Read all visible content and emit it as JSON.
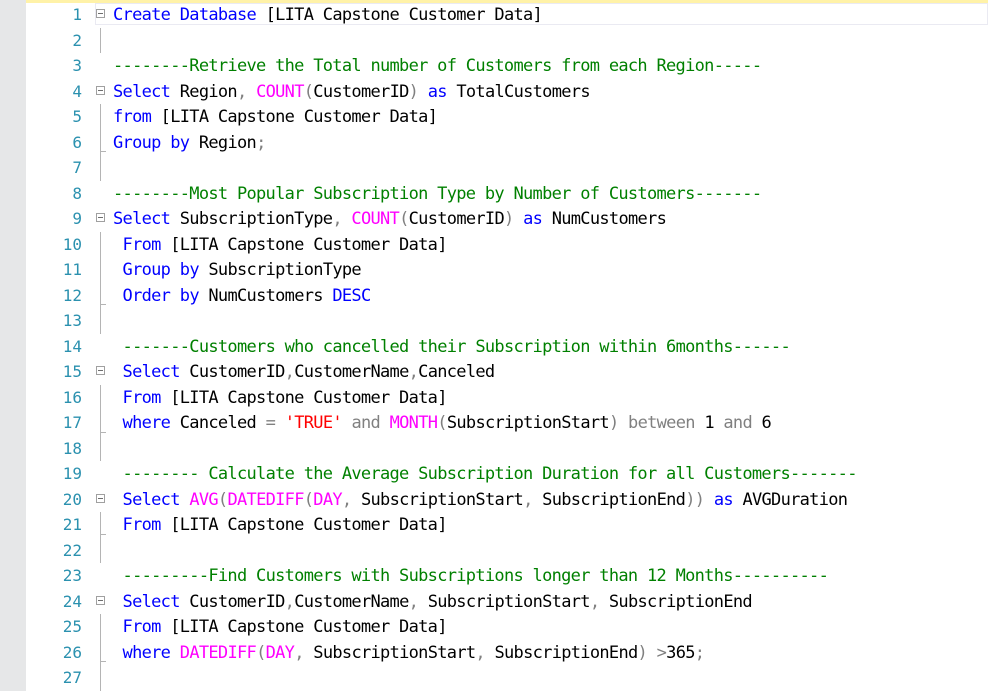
{
  "editor": {
    "colors": {
      "keyword": "#0000ff",
      "function": "#ff00ff",
      "comment": "#008000",
      "operator": "#808080",
      "string": "#ff0000",
      "text": "#000000",
      "line_number": "#2b91af"
    },
    "lines": [
      {
        "n": "1",
        "fold": true,
        "tokens": [
          [
            "kw",
            "Create"
          ],
          [
            "tx",
            " "
          ],
          [
            "kw",
            "Database"
          ],
          [
            "tx",
            " [LITA Capstone Customer Data]"
          ]
        ]
      },
      {
        "n": "2",
        "tokens": []
      },
      {
        "n": "3",
        "tokens": [
          [
            "cm",
            "--------Retrieve the Total number of Customers from each Region-----"
          ]
        ]
      },
      {
        "n": "4",
        "fold": true,
        "tokens": [
          [
            "kw",
            "Select"
          ],
          [
            "tx",
            " Region"
          ],
          [
            "op",
            ","
          ],
          [
            "tx",
            " "
          ],
          [
            "fn",
            "COUNT"
          ],
          [
            "op",
            "("
          ],
          [
            "tx",
            "CustomerID"
          ],
          [
            "op",
            ")"
          ],
          [
            "tx",
            " "
          ],
          [
            "kw",
            "as"
          ],
          [
            "tx",
            " TotalCustomers"
          ]
        ]
      },
      {
        "n": "5",
        "tokens": [
          [
            "kw",
            "from"
          ],
          [
            "tx",
            " [LITA Capstone Customer Data]"
          ]
        ]
      },
      {
        "n": "6",
        "tokens": [
          [
            "kw",
            "Group"
          ],
          [
            "tx",
            " "
          ],
          [
            "kw",
            "by"
          ],
          [
            "tx",
            " Region"
          ],
          [
            "op",
            ";"
          ]
        ]
      },
      {
        "n": "7",
        "tokens": []
      },
      {
        "n": "8",
        "tokens": [
          [
            "cm",
            "--------Most Popular Subscription Type by Number of Customers-------"
          ]
        ]
      },
      {
        "n": "9",
        "fold": true,
        "tokens": [
          [
            "kw",
            "Select"
          ],
          [
            "tx",
            " SubscriptionType"
          ],
          [
            "op",
            ","
          ],
          [
            "tx",
            " "
          ],
          [
            "fn",
            "COUNT"
          ],
          [
            "op",
            "("
          ],
          [
            "tx",
            "CustomerID"
          ],
          [
            "op",
            ")"
          ],
          [
            "tx",
            " "
          ],
          [
            "kw",
            "as"
          ],
          [
            "tx",
            " NumCustomers"
          ]
        ]
      },
      {
        "n": "10",
        "tokens": [
          [
            "tx",
            " "
          ],
          [
            "kw",
            "From"
          ],
          [
            "tx",
            " [LITA Capstone Customer Data]"
          ]
        ]
      },
      {
        "n": "11",
        "tokens": [
          [
            "tx",
            " "
          ],
          [
            "kw",
            "Group"
          ],
          [
            "tx",
            " "
          ],
          [
            "kw",
            "by"
          ],
          [
            "tx",
            " SubscriptionType"
          ]
        ]
      },
      {
        "n": "12",
        "tokens": [
          [
            "tx",
            " "
          ],
          [
            "kw",
            "Order"
          ],
          [
            "tx",
            " "
          ],
          [
            "kw",
            "by"
          ],
          [
            "tx",
            " NumCustomers "
          ],
          [
            "kw",
            "DESC"
          ]
        ]
      },
      {
        "n": "13",
        "tokens": []
      },
      {
        "n": "14",
        "tokens": [
          [
            "tx",
            " "
          ],
          [
            "cm",
            "-------Customers who cancelled their Subscription within 6months------"
          ]
        ]
      },
      {
        "n": "15",
        "fold": true,
        "tokens": [
          [
            "tx",
            " "
          ],
          [
            "kw",
            "Select"
          ],
          [
            "tx",
            " CustomerID"
          ],
          [
            "op",
            ","
          ],
          [
            "tx",
            "CustomerName"
          ],
          [
            "op",
            ","
          ],
          [
            "tx",
            "Canceled"
          ]
        ]
      },
      {
        "n": "16",
        "tokens": [
          [
            "tx",
            " "
          ],
          [
            "kw",
            "From"
          ],
          [
            "tx",
            " [LITA Capstone Customer Data]"
          ]
        ]
      },
      {
        "n": "17",
        "tokens": [
          [
            "tx",
            " "
          ],
          [
            "kw",
            "where"
          ],
          [
            "tx",
            " Canceled "
          ],
          [
            "op",
            "="
          ],
          [
            "tx",
            " "
          ],
          [
            "st",
            "'TRUE'"
          ],
          [
            "tx",
            " "
          ],
          [
            "op",
            "and"
          ],
          [
            "tx",
            " "
          ],
          [
            "fn",
            "MONTH"
          ],
          [
            "op",
            "("
          ],
          [
            "tx",
            "SubscriptionStart"
          ],
          [
            "op",
            ")"
          ],
          [
            "tx",
            " "
          ],
          [
            "op",
            "between"
          ],
          [
            "tx",
            " 1 "
          ],
          [
            "op",
            "and"
          ],
          [
            "tx",
            " 6"
          ]
        ]
      },
      {
        "n": "18",
        "tokens": []
      },
      {
        "n": "19",
        "tokens": [
          [
            "tx",
            " "
          ],
          [
            "cm",
            "-------- Calculate the Average Subscription Duration for all Customers-------"
          ]
        ]
      },
      {
        "n": "20",
        "fold": true,
        "tokens": [
          [
            "tx",
            " "
          ],
          [
            "kw",
            "Select"
          ],
          [
            "tx",
            " "
          ],
          [
            "fn",
            "AVG"
          ],
          [
            "op",
            "("
          ],
          [
            "fn",
            "DATEDIFF"
          ],
          [
            "op",
            "("
          ],
          [
            "fn",
            "DAY"
          ],
          [
            "op",
            ","
          ],
          [
            "tx",
            " SubscriptionStart"
          ],
          [
            "op",
            ","
          ],
          [
            "tx",
            " SubscriptionEnd"
          ],
          [
            "op",
            "))"
          ],
          [
            "tx",
            " "
          ],
          [
            "kw",
            "as"
          ],
          [
            "tx",
            " AVGDuration"
          ]
        ]
      },
      {
        "n": "21",
        "tokens": [
          [
            "tx",
            " "
          ],
          [
            "kw",
            "From"
          ],
          [
            "tx",
            " [LITA Capstone Customer Data]"
          ]
        ]
      },
      {
        "n": "22",
        "tokens": []
      },
      {
        "n": "23",
        "tokens": [
          [
            "tx",
            " "
          ],
          [
            "cm",
            "---------Find Customers with Subscriptions longer than 12 Months----------"
          ]
        ]
      },
      {
        "n": "24",
        "fold": true,
        "tokens": [
          [
            "tx",
            " "
          ],
          [
            "kw",
            "Select"
          ],
          [
            "tx",
            " CustomerID"
          ],
          [
            "op",
            ","
          ],
          [
            "tx",
            "CustomerName"
          ],
          [
            "op",
            ","
          ],
          [
            "tx",
            " SubscriptionStart"
          ],
          [
            "op",
            ","
          ],
          [
            "tx",
            " SubscriptionEnd"
          ]
        ]
      },
      {
        "n": "25",
        "tokens": [
          [
            "tx",
            " "
          ],
          [
            "kw",
            "From"
          ],
          [
            "tx",
            " [LITA Capstone Customer Data]"
          ]
        ]
      },
      {
        "n": "26",
        "tokens": [
          [
            "tx",
            " "
          ],
          [
            "kw",
            "where"
          ],
          [
            "tx",
            " "
          ],
          [
            "fn",
            "DATEDIFF"
          ],
          [
            "op",
            "("
          ],
          [
            "fn",
            "DAY"
          ],
          [
            "op",
            ","
          ],
          [
            "tx",
            " SubscriptionStart"
          ],
          [
            "op",
            ","
          ],
          [
            "tx",
            " SubscriptionEnd"
          ],
          [
            "op",
            ")"
          ],
          [
            "tx",
            " "
          ],
          [
            "op",
            ">"
          ],
          [
            "tx",
            "365"
          ],
          [
            "op",
            ";"
          ]
        ]
      },
      {
        "n": "27",
        "tokens": []
      }
    ]
  }
}
